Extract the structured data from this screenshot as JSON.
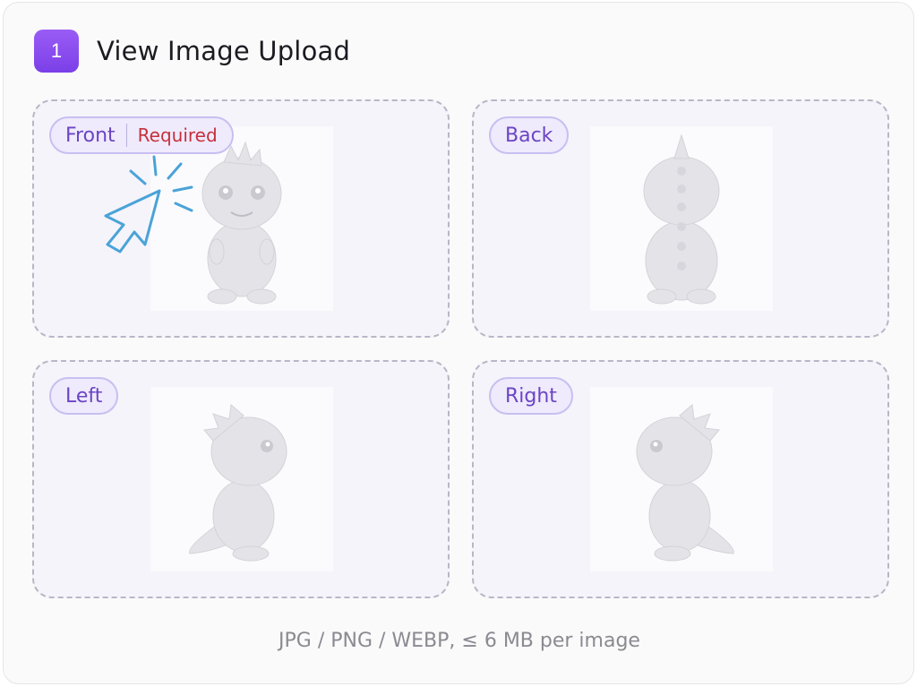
{
  "header": {
    "step_number": "1",
    "title": "View Image Upload"
  },
  "slots": [
    {
      "label": "Front",
      "required_label": "Required"
    },
    {
      "label": "Back"
    },
    {
      "label": "Left"
    },
    {
      "label": "Right"
    }
  ],
  "footer": {
    "hint": "JPG / PNG / WEBP, ≤ 6 MB per image"
  },
  "colors": {
    "accent": "#7b3fe8",
    "required": "#c6303c",
    "cursor": "#4aa3d8"
  },
  "icons": {
    "cursor": "click-cursor-icon"
  }
}
